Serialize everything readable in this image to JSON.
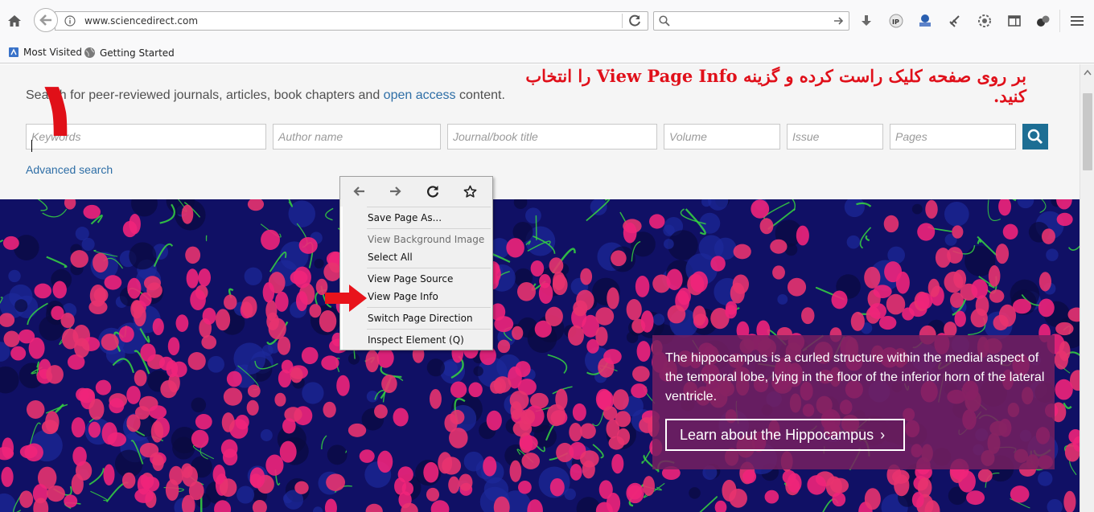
{
  "browser": {
    "url": "www.sciencedirect.com",
    "bookmarks": [
      "Most Visited",
      "Getting Started"
    ]
  },
  "page": {
    "intro_prefix": "Search for peer-reviewed journals, articles, book chapters and ",
    "intro_link": "open access",
    "intro_suffix": " content.",
    "fields": {
      "keywords": "Keywords",
      "author": "Author name",
      "journal": "Journal/book title",
      "volume": "Volume",
      "issue": "Issue",
      "pages": "Pages"
    },
    "advanced_search": "Advanced search",
    "hero_text": "The hippocampus is a curled structure within the medial aspect of the temporal lobe, lying in the floor of the inferior horn of the lateral ventricle.",
    "hero_button": "Learn about the Hippocampus"
  },
  "context_menu": {
    "items": [
      {
        "label": "Save Page As...",
        "enabled": true
      },
      {
        "label": "View Background Image",
        "enabled": false
      },
      {
        "label": "Select All",
        "enabled": true
      },
      {
        "label": "View Page Source",
        "enabled": true
      },
      {
        "label": "View Page Info",
        "enabled": true
      },
      {
        "label": "Switch Page Direction",
        "enabled": true
      },
      {
        "label": "Inspect Element (Q)",
        "enabled": true
      }
    ]
  },
  "annotation": {
    "instruction": "بر روی صفحه کلیک راست کرده و گزینه View Page Info را انتخاب کنید.",
    "step_number": "۱",
    "accent_color": "#e0101a"
  },
  "colors": {
    "link": "#2e6ea6",
    "search_button": "#1d6e94",
    "hero_card": "#762060"
  },
  "icons": [
    "home-icon",
    "back-arrow-icon",
    "info-icon",
    "reload-icon",
    "search-icon",
    "download-icon",
    "menu-icon"
  ]
}
